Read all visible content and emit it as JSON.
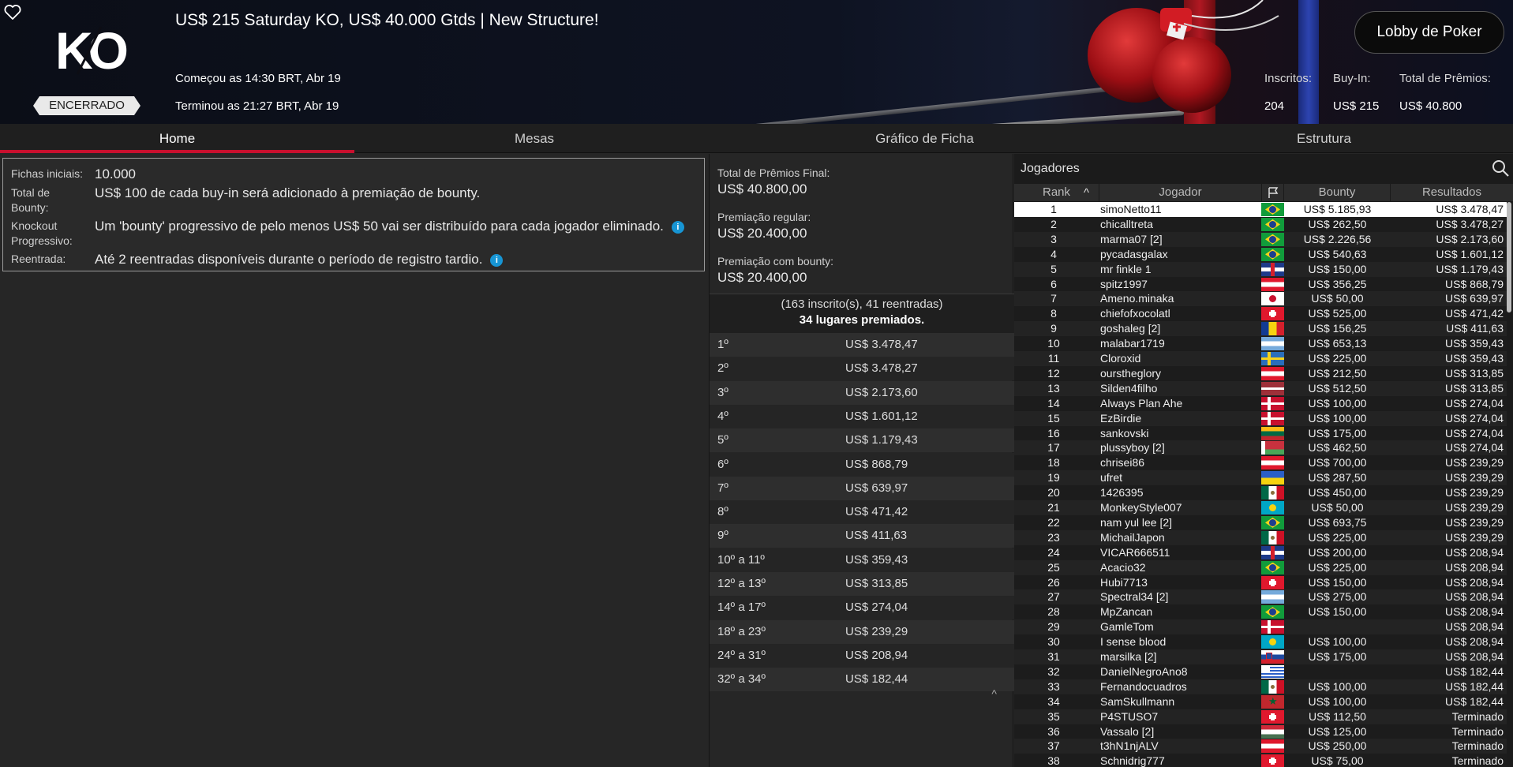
{
  "header": {
    "logo_text": "KO",
    "status_badge": "ENCERRADO",
    "title": "US$ 215 Saturday KO, US$ 40.000 Gtds | New Structure!",
    "started": "Começou as 14:30 BRT, Abr 19",
    "ended": "Terminou as 21:27 BRT, Abr 19",
    "lobby_button": "Lobby de Poker",
    "stats": {
      "entrants_label": "Inscritos:",
      "entrants_value": "204",
      "buyin_label": "Buy-In:",
      "buyin_value": "US$ 215",
      "prize_label": "Total de Prêmios:",
      "prize_value": "US$ 40.800"
    }
  },
  "tabs": [
    {
      "label": "Home",
      "active": true
    },
    {
      "label": "Mesas",
      "active": false
    },
    {
      "label": "Gráfico de Ficha",
      "active": false
    },
    {
      "label": "Estrutura",
      "active": false
    }
  ],
  "info": {
    "rows": [
      {
        "label": "Fichas iniciais:",
        "value": "10.000"
      },
      {
        "label": "Total de Bounty:",
        "value": "US$ 100 de cada buy-in será adicionado à premiação de bounty."
      },
      {
        "label": "Knockout Progressivo:",
        "value": "Um 'bounty' progressivo de pelo menos US$ 50 vai ser distribuído para cada jogador eliminado.",
        "info": true
      },
      {
        "label": "Reentrada:",
        "value": "Até 2 reentradas disponíveis durante o período de registro tardio.",
        "info": true
      }
    ],
    "info_glyph": "i"
  },
  "prizes": {
    "total_label": "Total de Prêmios Final:",
    "total_value": "US$ 40.800,00",
    "regular_label": "Premiação regular:",
    "regular_value": "US$ 20.400,00",
    "bounty_label": "Premiação com bounty:",
    "bounty_value": "US$ 20.400,00",
    "entries_line": "(163 inscrito(s), 41 reentradas)",
    "paid_line": "34 lugares premiados.",
    "payouts": [
      {
        "place": "1º",
        "amount": "US$ 3.478,47"
      },
      {
        "place": "2º",
        "amount": "US$ 3.478,27"
      },
      {
        "place": "3º",
        "amount": "US$ 2.173,60"
      },
      {
        "place": "4º",
        "amount": "US$ 1.601,12"
      },
      {
        "place": "5º",
        "amount": "US$ 1.179,43"
      },
      {
        "place": "6º",
        "amount": "US$ 868,79"
      },
      {
        "place": "7º",
        "amount": "US$ 639,97"
      },
      {
        "place": "8º",
        "amount": "US$ 471,42"
      },
      {
        "place": "9º",
        "amount": "US$ 411,63"
      },
      {
        "place": "10º a 11º",
        "amount": "US$ 359,43"
      },
      {
        "place": "12º a 13º",
        "amount": "US$ 313,85"
      },
      {
        "place": "14º a 17º",
        "amount": "US$ 274,04"
      },
      {
        "place": "18º a 23º",
        "amount": "US$ 239,29"
      },
      {
        "place": "24º a 31º",
        "amount": "US$ 208,94"
      },
      {
        "place": "32º a 34º",
        "amount": "US$ 182,44"
      }
    ],
    "collapse_glyph": "^"
  },
  "players": {
    "title": "Jogadores",
    "sort_glyph": "^",
    "columns": {
      "rank": "Rank",
      "player": "Jogador",
      "bounty": "Bounty",
      "results": "Resultados"
    },
    "rows": [
      {
        "rank": "1",
        "name": "simoNetto11",
        "flag": "br",
        "bounty": "US$ 5.185,93",
        "result": "US$ 3.478,47",
        "selected": true
      },
      {
        "rank": "2",
        "name": "chicalltreta",
        "flag": "br",
        "bounty": "US$ 262,50",
        "result": "US$ 3.478,27"
      },
      {
        "rank": "3",
        "name": "marma07 [2]",
        "flag": "br",
        "bounty": "US$ 2.226,56",
        "result": "US$ 2.173,60"
      },
      {
        "rank": "4",
        "name": "pycadasgalax",
        "flag": "br",
        "bounty": "US$ 540,63",
        "result": "US$ 1.601,12"
      },
      {
        "rank": "5",
        "name": "mr finkle 1",
        "flag": "uk",
        "bounty": "US$ 150,00",
        "result": "US$ 1.179,43"
      },
      {
        "rank": "6",
        "name": "spitz1997",
        "flag": "at",
        "bounty": "US$ 356,25",
        "result": "US$ 868,79"
      },
      {
        "rank": "7",
        "name": "Ameno.minaka",
        "flag": "jp",
        "bounty": "US$ 50,00",
        "result": "US$ 639,97"
      },
      {
        "rank": "8",
        "name": "chiefofxocolatl",
        "flag": "ch",
        "bounty": "US$ 525,00",
        "result": "US$ 471,42"
      },
      {
        "rank": "9",
        "name": "goshaleg [2]",
        "flag": "ro",
        "bounty": "US$ 156,25",
        "result": "US$ 411,63"
      },
      {
        "rank": "10",
        "name": "malabar1719",
        "flag": "ar",
        "bounty": "US$ 653,13",
        "result": "US$ 359,43"
      },
      {
        "rank": "11",
        "name": "Cloroxid",
        "flag": "se",
        "bounty": "US$ 225,00",
        "result": "US$ 359,43"
      },
      {
        "rank": "12",
        "name": "oursthеglory",
        "flag": "at",
        "bounty": "US$ 212,50",
        "result": "US$ 313,85"
      },
      {
        "rank": "13",
        "name": "Silden4filho",
        "flag": "lv",
        "bounty": "US$ 512,50",
        "result": "US$ 313,85"
      },
      {
        "rank": "14",
        "name": "Always Plan Ahe",
        "flag": "dk",
        "bounty": "US$ 100,00",
        "result": "US$ 274,04"
      },
      {
        "rank": "15",
        "name": "EzBirdie",
        "flag": "dk",
        "bounty": "US$ 100,00",
        "result": "US$ 274,04"
      },
      {
        "rank": "16",
        "name": "sankovski",
        "flag": "lt",
        "bounty": "US$ 175,00",
        "result": "US$ 274,04"
      },
      {
        "rank": "17",
        "name": "plussyboy [2]",
        "flag": "by",
        "bounty": "US$ 462,50",
        "result": "US$ 274,04"
      },
      {
        "rank": "18",
        "name": "chrisei86",
        "flag": "at",
        "bounty": "US$ 700,00",
        "result": "US$ 239,29"
      },
      {
        "rank": "19",
        "name": "ufret",
        "flag": "ua",
        "bounty": "US$ 287,50",
        "result": "US$ 239,29"
      },
      {
        "rank": "20",
        "name": "1426395",
        "flag": "mx",
        "bounty": "US$ 450,00",
        "result": "US$ 239,29"
      },
      {
        "rank": "21",
        "name": "MonkeyStyle007",
        "flag": "kz",
        "bounty": "US$ 50,00",
        "result": "US$ 239,29"
      },
      {
        "rank": "22",
        "name": "nam yul lee [2]",
        "flag": "br",
        "bounty": "US$ 693,75",
        "result": "US$ 239,29"
      },
      {
        "rank": "23",
        "name": "MichailJapon",
        "flag": "mx",
        "bounty": "US$ 225,00",
        "result": "US$ 239,29"
      },
      {
        "rank": "24",
        "name": "VICAR666511",
        "flag": "uk",
        "bounty": "US$ 200,00",
        "result": "US$ 208,94"
      },
      {
        "rank": "25",
        "name": "Acacio32",
        "flag": "br",
        "bounty": "US$ 225,00",
        "result": "US$ 208,94"
      },
      {
        "rank": "26",
        "name": "Hubi7713",
        "flag": "ch",
        "bounty": "US$ 150,00",
        "result": "US$ 208,94"
      },
      {
        "rank": "27",
        "name": "Spectral34 [2]",
        "flag": "ar",
        "bounty": "US$ 275,00",
        "result": "US$ 208,94"
      },
      {
        "rank": "28",
        "name": "MpZancan",
        "flag": "br",
        "bounty": "US$ 150,00",
        "result": "US$ 208,94"
      },
      {
        "rank": "29",
        "name": "GamleTom",
        "flag": "dk",
        "bounty": "",
        "result": "US$ 208,94"
      },
      {
        "rank": "30",
        "name": "I sense blood",
        "flag": "kz",
        "bounty": "US$ 100,00",
        "result": "US$ 208,94"
      },
      {
        "rank": "31",
        "name": "marsilka [2]",
        "flag": "si",
        "bounty": "US$ 175,00",
        "result": "US$ 208,94"
      },
      {
        "rank": "32",
        "name": "DanielNegroAno8",
        "flag": "uy",
        "bounty": "",
        "result": "US$ 182,44"
      },
      {
        "rank": "33",
        "name": "Fernandocuadros",
        "flag": "mx",
        "bounty": "US$ 100,00",
        "result": "US$ 182,44"
      },
      {
        "rank": "34",
        "name": "SamSkullmann",
        "flag": "ma",
        "bounty": "US$ 100,00",
        "result": "US$ 182,44"
      },
      {
        "rank": "35",
        "name": "P4STUSO7",
        "flag": "ch",
        "bounty": "US$ 112,50",
        "result": "Terminado"
      },
      {
        "rank": "36",
        "name": "Vassalo [2]",
        "flag": "hu",
        "bounty": "US$ 125,00",
        "result": "Terminado"
      },
      {
        "rank": "37",
        "name": "t3hN1njALV",
        "flag": "at",
        "bounty": "US$ 250,00",
        "result": "Terminado"
      },
      {
        "rank": "38",
        "name": "Schnidrig777",
        "flag": "ch",
        "bounty": "US$ 75,00",
        "result": "Terminado"
      }
    ]
  },
  "colors": {
    "accent": "#c8102e",
    "info_dot": "#1795d4",
    "background": "#262626"
  }
}
